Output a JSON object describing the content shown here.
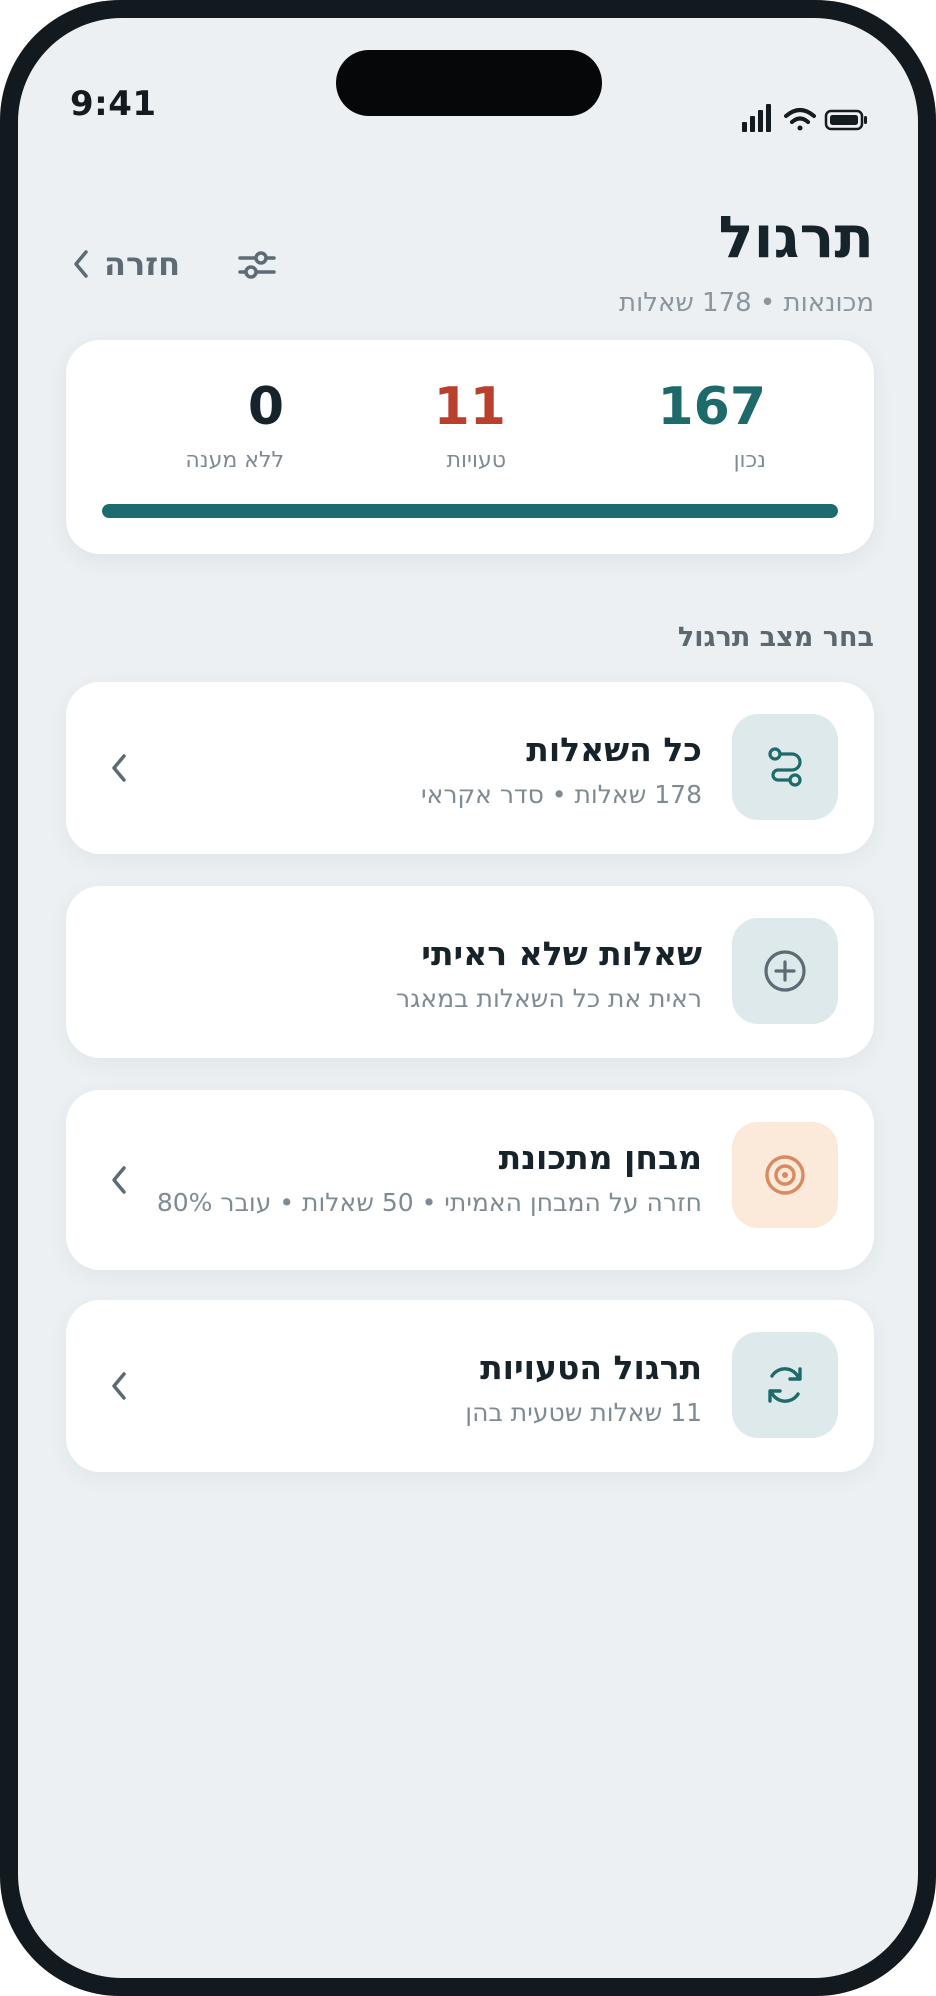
{
  "status_bar": {
    "time": "9:41"
  },
  "header": {
    "title": "תרגול",
    "subtitle": "מכונאות • 178 שאלות",
    "back_label": "חזרה"
  },
  "stats": {
    "correct": {
      "value": "167",
      "label": "נכון"
    },
    "wrong": {
      "value": "11",
      "label": "טעויות"
    },
    "unanswered": {
      "value": "0",
      "label": "ללא מענה"
    },
    "progress_fraction": 1.0
  },
  "section_label": "בחר מצב תרגול",
  "modes": [
    {
      "title": "כל השאלות",
      "subtitle": "178 שאלות • סדר אקראי",
      "icon": "route-icon"
    },
    {
      "title": "שאלות שלא ראיתי",
      "subtitle": "ראית את כל השאלות במאגר",
      "icon": "plus-circle-icon"
    },
    {
      "title": "מבחן מתכונת",
      "subtitle": "חזרה על המבחן האמיתי • 50 שאלות • עובר 80%",
      "icon": "target-icon"
    },
    {
      "title": "תרגול הטעויות",
      "subtitle": "11 שאלות שטעית בהן",
      "icon": "refresh-icon"
    }
  ],
  "colors": {
    "accent": "#1b6b6f",
    "correct": "#1e6a6b",
    "wrong": "#b8402d",
    "target_icon": "#d98a5e",
    "background": "#ecf0f3"
  }
}
